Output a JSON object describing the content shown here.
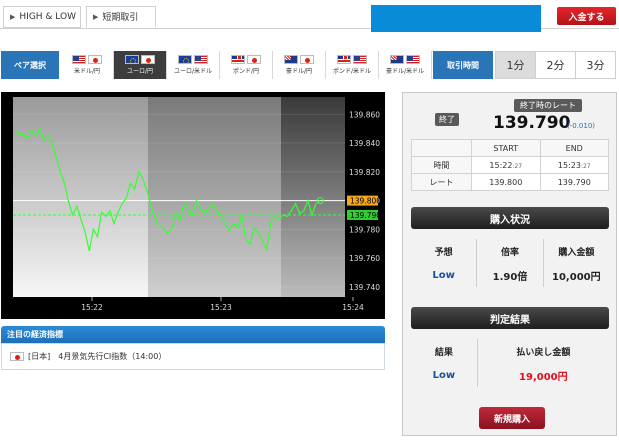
{
  "tabs": [
    {
      "label": "HIGH & LOW",
      "active": false
    },
    {
      "label": "短期取引",
      "active": true
    }
  ],
  "header": {
    "deposit_label": "入金する"
  },
  "pair_select": {
    "label": "ペア選択",
    "pairs": [
      {
        "label": "米ドル/円",
        "flags": [
          "us",
          "jp"
        ],
        "active": false
      },
      {
        "label": "ユーロ/円",
        "flags": [
          "eu",
          "jp"
        ],
        "active": true
      },
      {
        "label": "ユーロ/米ドル",
        "flags": [
          "eu",
          "us"
        ],
        "active": false
      },
      {
        "label": "ポンド/円",
        "flags": [
          "gb",
          "jp"
        ],
        "active": false
      },
      {
        "label": "豪ドル/円",
        "flags": [
          "au",
          "jp"
        ],
        "active": false
      },
      {
        "label": "ポンド/米ドル",
        "flags": [
          "gb",
          "us"
        ],
        "active": false
      },
      {
        "label": "豪ドル/米ドル",
        "flags": [
          "au",
          "us"
        ],
        "active": false
      }
    ]
  },
  "trade_time": {
    "label": "取引時間",
    "options": [
      {
        "label": "1分",
        "active": true
      },
      {
        "label": "2分",
        "active": false
      },
      {
        "label": "3分",
        "active": false
      }
    ]
  },
  "chart_data": {
    "type": "line",
    "x_ticks": [
      "15:22",
      "15:23",
      "15:24"
    ],
    "y_ticks": [
      "139.860",
      "139.840",
      "139.820",
      "139.800",
      "139.780",
      "139.760",
      "139.740"
    ],
    "ylim": [
      139.733,
      139.872
    ],
    "start_rate": 139.8,
    "end_rate": 139.79,
    "start_label": "139.800",
    "end_label": "139.790",
    "xlim": [
      0,
      80
    ],
    "series": [
      {
        "x": [
          0,
          1,
          2,
          3,
          4,
          5,
          6,
          7,
          8,
          9,
          10,
          11,
          12,
          13,
          14,
          15,
          16,
          17,
          18,
          19,
          20,
          21,
          22,
          23,
          24,
          25,
          26,
          27,
          28,
          29,
          30,
          31,
          32,
          33,
          34,
          35,
          36,
          37,
          38,
          39,
          40,
          41,
          42,
          43,
          44,
          45,
          46,
          47,
          48,
          49,
          50,
          51,
          52,
          53,
          54,
          55,
          56,
          57,
          58,
          59,
          60,
          61,
          62,
          63,
          64,
          65,
          66,
          67,
          68,
          69,
          70,
          71,
          72,
          73,
          74
        ],
        "values": [
          139.849,
          139.846,
          139.846,
          139.843,
          139.849,
          139.845,
          139.85,
          139.842,
          139.845,
          139.84,
          139.83,
          139.82,
          139.812,
          139.799,
          139.79,
          139.796,
          139.787,
          139.778,
          139.765,
          139.78,
          139.775,
          139.792,
          139.789,
          139.793,
          139.784,
          139.792,
          139.798,
          139.802,
          139.812,
          139.808,
          139.82,
          139.815,
          139.807,
          139.796,
          139.787,
          139.783,
          139.781,
          139.777,
          139.781,
          139.791,
          139.787,
          139.798,
          139.794,
          139.79,
          139.8,
          139.795,
          139.791,
          139.795,
          139.798,
          139.793,
          139.79,
          139.783,
          139.779,
          139.784,
          139.781,
          139.79,
          139.772,
          139.77,
          139.781,
          139.778,
          139.772,
          139.766,
          139.785,
          139.789,
          139.787,
          139.79,
          139.789,
          139.793,
          139.798,
          139.791,
          139.793,
          139.8,
          139.79,
          139.798,
          139.8
        ]
      }
    ]
  },
  "econ": {
    "title": "注目の経済指標",
    "items": [
      {
        "country": "[日本]",
        "text": "4月景気先行CI指数（14:00）"
      }
    ]
  },
  "panel": {
    "status": "終了",
    "rate_label": "終了時のレート",
    "rate": "139.790",
    "rate_change": "(-0.010)",
    "times": {
      "headers": [
        "",
        "START",
        "END"
      ],
      "time_label": "時間",
      "start_time": "15:22",
      "start_sec": ":27",
      "end_time": "15:23",
      "end_sec": ":27",
      "rate_label": "レート",
      "start_rate": "139.800",
      "end_rate": "139.790"
    },
    "purchase": {
      "title": "購入状況",
      "headers": [
        "予想",
        "倍率",
        "購入金額"
      ],
      "values": [
        "Low",
        "1.90倍",
        "10,000円"
      ]
    },
    "result": {
      "title": "判定結果",
      "headers": [
        "結果",
        "払い戻し金額"
      ],
      "values": [
        "Low",
        "19,000円"
      ]
    },
    "new_purchase": "新規購入"
  },
  "colors": {
    "accent_blue": "#0a8bd8",
    "deposit_red": "#d01e24",
    "line_green": "#33ff33",
    "low_blue": "#1a4f9c",
    "payout_red": "#e0101e"
  }
}
